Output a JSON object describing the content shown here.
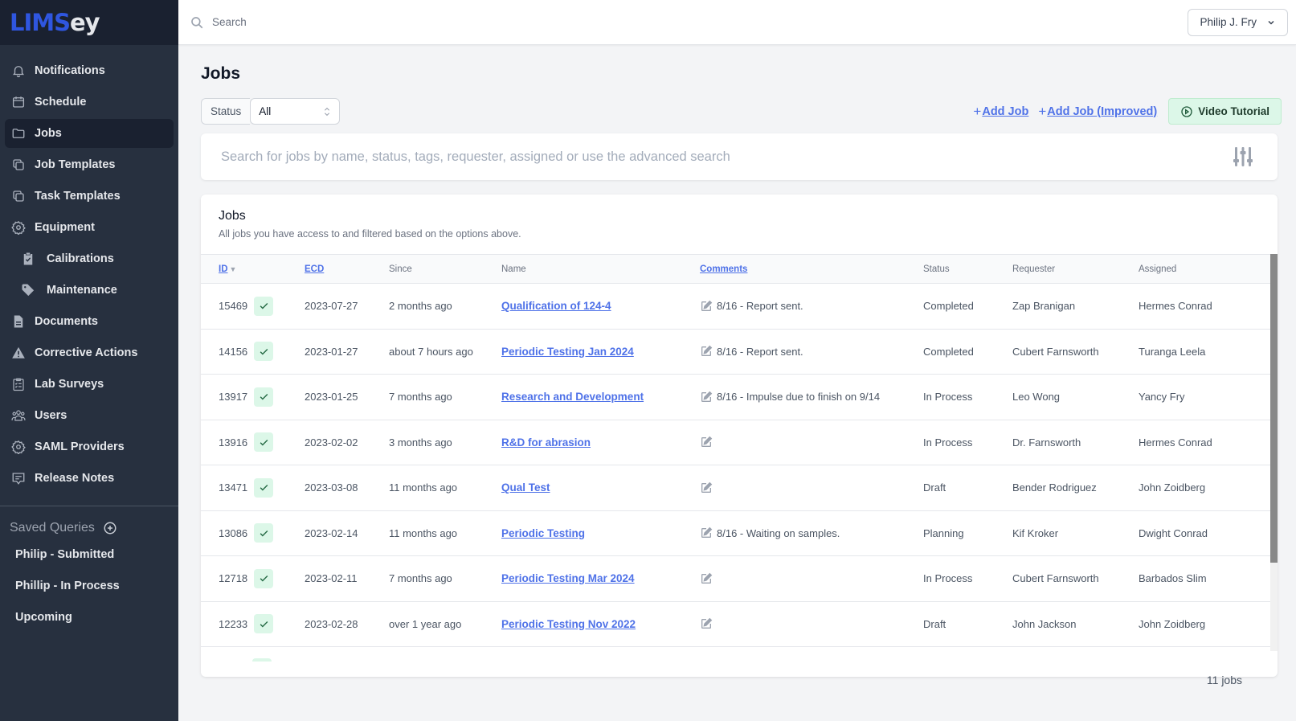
{
  "app": {
    "logo_part1": "LIMS",
    "logo_part2": "ey"
  },
  "sidebar": {
    "items": [
      {
        "label": "Notifications",
        "icon": "bell-icon"
      },
      {
        "label": "Schedule",
        "icon": "calendar-icon"
      },
      {
        "label": "Jobs",
        "icon": "folder-icon",
        "active": true
      },
      {
        "label": "Job Templates",
        "icon": "copy-icon"
      },
      {
        "label": "Task Templates",
        "icon": "copy-icon"
      },
      {
        "label": "Equipment",
        "icon": "gear-icon"
      },
      {
        "label": "Calibrations",
        "icon": "clipboard-check-icon",
        "sub": true
      },
      {
        "label": "Maintenance",
        "icon": "tag-icon",
        "sub": true
      },
      {
        "label": "Documents",
        "icon": "document-icon"
      },
      {
        "label": "Corrective Actions",
        "icon": "warning-icon"
      },
      {
        "label": "Lab Surveys",
        "icon": "clipboard-list-icon"
      },
      {
        "label": "Users",
        "icon": "users-icon"
      },
      {
        "label": "SAML Providers",
        "icon": "gear-icon"
      },
      {
        "label": "Release Notes",
        "icon": "chat-icon"
      }
    ],
    "saved_queries_label": "Saved Queries",
    "saved_queries": [
      {
        "label": "Philip - Submitted"
      },
      {
        "label": "Phillip - In Process"
      },
      {
        "label": "Upcoming"
      }
    ]
  },
  "topbar": {
    "search_placeholder": "Search",
    "user_name": "Philip J. Fry"
  },
  "page": {
    "title": "Jobs",
    "status_label": "Status",
    "status_value": "All",
    "add_job_label": "Add Job",
    "add_job_improved_label": "Add Job (Improved)",
    "video_tutorial_label": "Video Tutorial",
    "search_placeholder": "Search for jobs by name, status, tags, requester, assigned or use the advanced search",
    "job_count": "11 jobs"
  },
  "table": {
    "title": "Jobs",
    "subtitle": "All jobs you have access to and filtered based on the options above.",
    "columns": {
      "id": "ID",
      "ecd": "ECD",
      "since": "Since",
      "name": "Name",
      "comments": "Comments",
      "status": "Status",
      "requester": "Requester",
      "assigned": "Assigned"
    },
    "rows": [
      {
        "id": "15469",
        "ecd": "2023-07-27",
        "since": "2 months ago",
        "name": "Qualification of 124-4",
        "comment": "8/16 - Report sent.",
        "status": "Completed",
        "requester": "Zap Branigan",
        "assigned": "Hermes Conrad"
      },
      {
        "id": "14156",
        "ecd": "2023-01-27",
        "since": "about 7 hours ago",
        "name": "Periodic Testing Jan 2024",
        "comment": "8/16 - Report sent.",
        "status": "Completed",
        "requester": "Cubert Farnsworth",
        "assigned": "Turanga Leela"
      },
      {
        "id": "13917",
        "ecd": "2023-01-25",
        "since": "7 months ago",
        "name": "Research and Development",
        "comment": "8/16 - Impulse due to finish on 9/14",
        "status": "In Process",
        "requester": "Leo Wong",
        "assigned": "Yancy Fry"
      },
      {
        "id": "13916",
        "ecd": "2023-02-02",
        "since": "3 months ago",
        "name": "R&D for abrasion",
        "comment": "",
        "status": "In Process",
        "requester": "Dr. Farnsworth",
        "assigned": "Hermes Conrad"
      },
      {
        "id": "13471",
        "ecd": "2023-03-08",
        "since": "11 months ago",
        "name": "Qual Test",
        "comment": "",
        "status": "Draft",
        "requester": "Bender Rodriguez",
        "assigned": "John Zoidberg"
      },
      {
        "id": "13086",
        "ecd": "2023-02-14",
        "since": "11 months ago",
        "name": "Periodic Testing",
        "comment": "8/16 - Waiting on samples.",
        "status": "Planning",
        "requester": "Kif Kroker",
        "assigned": "Dwight Conrad"
      },
      {
        "id": "12718",
        "ecd": "2023-02-11",
        "since": "7 months ago",
        "name": "Periodic Testing Mar 2024",
        "comment": "",
        "status": "In Process",
        "requester": "Cubert Farnsworth",
        "assigned": "Barbados Slim"
      },
      {
        "id": "12233",
        "ecd": "2023-02-28",
        "since": "over 1 year ago",
        "name": "Periodic Testing Nov 2022",
        "comment": "",
        "status": "Draft",
        "requester": "John Jackson",
        "assigned": "John Zoidberg"
      }
    ]
  }
}
